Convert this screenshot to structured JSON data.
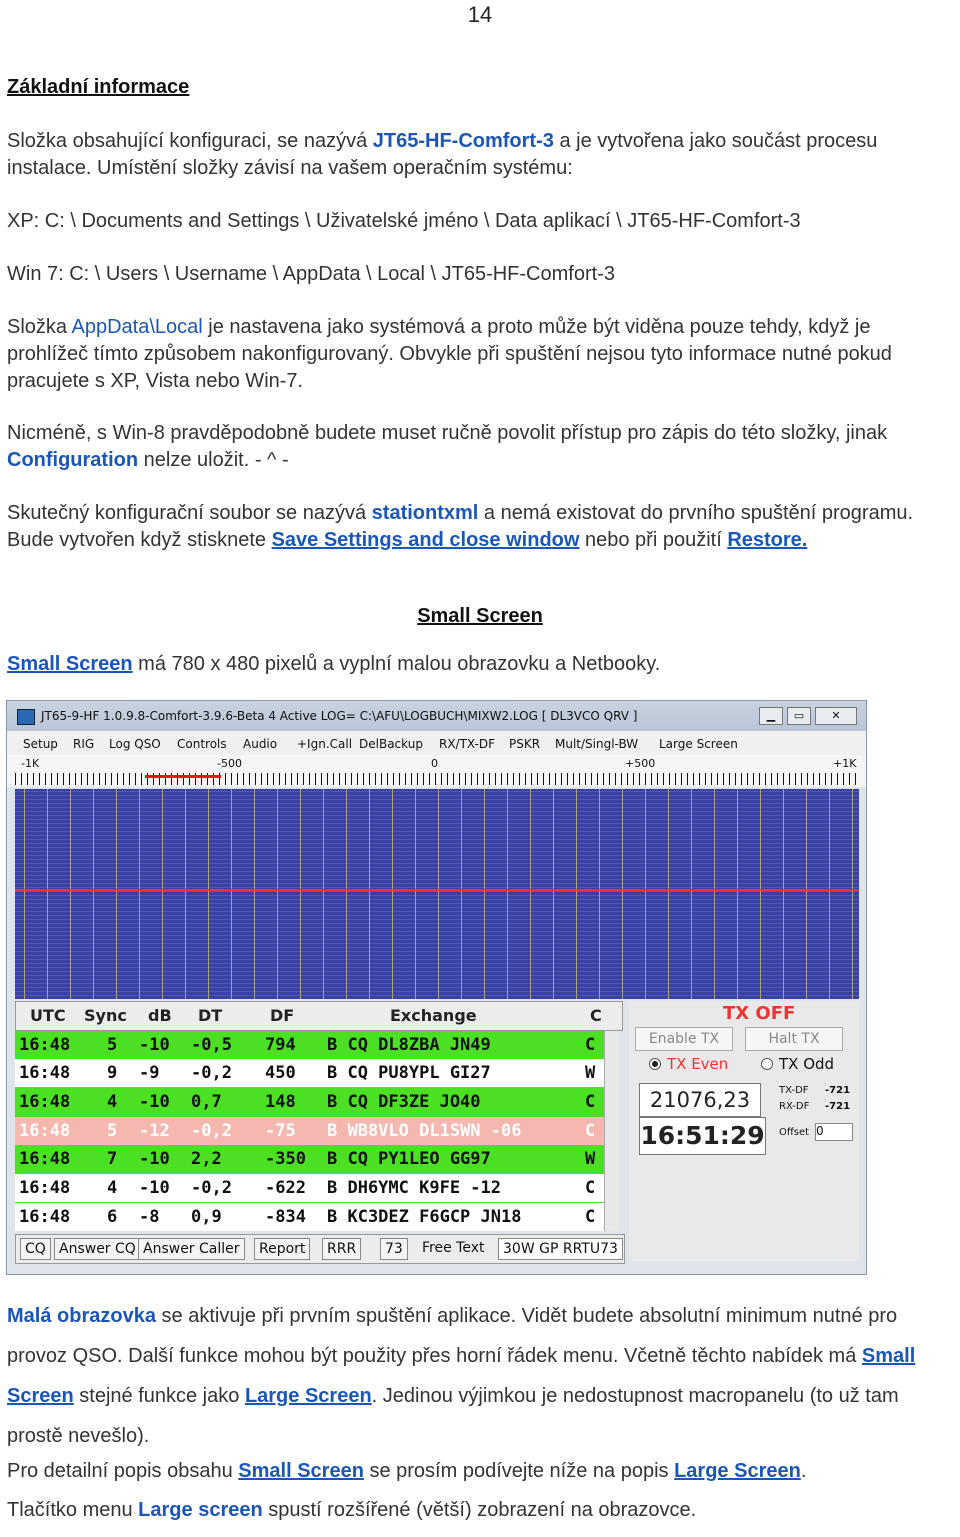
{
  "page_number": "14",
  "heading": "Základní informace",
  "p1": {
    "a": "Složka obsahující konfiguraci, se nazývá ",
    "b": "JT65-HF-Comfort-3",
    "c": " a je vytvořena jako součást procesu instalace. Umístění složky závisí na vašem operačním systému:"
  },
  "xp_path": "XP: C: \\ Documents and Settings \\ Uživatelské jméno \\ Data aplikací \\ JT65-HF-Comfort-3",
  "win7_path": "Win 7: C: \\ Users \\ Username \\ AppData \\ Local \\ JT65-HF-Comfort-3",
  "p2": {
    "a": "Složka ",
    "b": "AppData\\Local",
    "c": " je nastavena jako systémová a proto může být viděna pouze tehdy, když je prohlížeč tímto způsobem nakonfigurovaný. Obvykle  při spuštění nejsou tyto informace nutné pokud pracujete s XP, Vista nebo Win-7."
  },
  "p3": {
    "a": "Nicméně, s Win-8 pravděpodobně budete muset ručně povolit přístup pro zápis do této složky, jinak ",
    "b": "Configuration",
    "c": " nelze uložit. - ^ -"
  },
  "p4": {
    "a": "Skutečný konfigurační soubor se nazývá ",
    "b": "stationtxml",
    "c": " a nemá existovat do prvního spuštění programu. Bude vytvořen když stisknete ",
    "d": "Save Settings and close window",
    "e": " nebo při použití ",
    "f": "Restore."
  },
  "section_heading": "Small Screen",
  "p5": {
    "a": "Small Screen",
    "b": "  má 780 x 480 pixelů a vyplní malou obrazovku a Netbooky."
  },
  "app": {
    "title": "JT65-9-HF 1.0.9.8-Comfort-3.9.6-Beta 4 Active LOG= C:\\AFU\\LOGBUCH\\MIXW2.LOG  [ DL3VCO QRV ]",
    "menu": [
      "Setup",
      "RIG",
      "Log QSO",
      "Controls",
      "Audio",
      "+Ign.Call",
      "DelBackup",
      "RX/TX-DF",
      "PSKR",
      "Mult/Singl-BW",
      "Large Screen"
    ],
    "scale": [
      "-1K",
      "-500",
      "0",
      "+500",
      "+1K"
    ],
    "columns": [
      "UTC",
      "Sync",
      "dB",
      "DT",
      "DF",
      "Exchange",
      "C"
    ],
    "rows": [
      [
        "16:48",
        "5",
        "-10",
        "-0,5",
        "794",
        "B CQ DL8ZBA JN49",
        "C"
      ],
      [
        "16:48",
        "9",
        "-9",
        "-0,2",
        "450",
        "B CQ PU8YPL GI27",
        "W"
      ],
      [
        "16:48",
        "4",
        "-10",
        "0,7",
        "148",
        "B CQ DF3ZE JO40",
        "C"
      ],
      [
        "16:48",
        "5",
        "-12",
        "-0,2",
        "-75",
        "B WB8VLO DL1SWN -06",
        "C"
      ],
      [
        "16:48",
        "7",
        "-10",
        "2,2",
        "-350",
        "B CQ PY1LEO GG97",
        "W"
      ],
      [
        "16:48",
        "4",
        "-10",
        "-0,2",
        "-622",
        "B DH6YMC K9FE -12",
        "C"
      ],
      [
        "16:48",
        "6",
        "-8",
        "0,9",
        "-834",
        "B KC3DEZ F6GCP JN18",
        "C"
      ]
    ],
    "buttons": [
      "CQ",
      "Answer CQ",
      "Answer Caller",
      "Report",
      "RRR",
      "73",
      "Free Text",
      "30W GP RRTU73"
    ],
    "tx_status": "TX OFF",
    "enable_tx": "Enable TX",
    "halt_tx": "Halt TX",
    "tx_even": "TX Even",
    "tx_odd": "TX Odd",
    "frequency": "21076,23",
    "clock": "16:51:29",
    "tx_df_label": "TX-DF",
    "tx_df": "-721",
    "rx_df_label": "RX-DF",
    "rx_df": "-721",
    "offset_label": "Offset",
    "offset": "0"
  },
  "p6": {
    "a": "Malá obrazovka",
    "b": " se aktivuje při prvním spuštění aplikace. Vidět budete absolutní minimum nutné pro provoz QSO. Další funkce mohou být použity přes horní řádek menu. Včetně těchto nabídek má ",
    "c": "Small Screen",
    "d": "  stejné funkce jako ",
    "e": "Large Screen",
    "f": ". Jedinou výjimkou je nedostupnost macropanelu (to už tam prostě nevešlo)."
  },
  "p7": {
    "a": "Pro detailní popis obsahu ",
    "b": "Small Screen",
    "c": "  se prosím podívejte níže na popis ",
    "d": "Large Screen",
    "e": "."
  },
  "p8": {
    "a": "Tlačítko menu ",
    "b": "Large screen",
    "c": " spustí rozšířené (větší) zobrazení na obrazovce."
  }
}
